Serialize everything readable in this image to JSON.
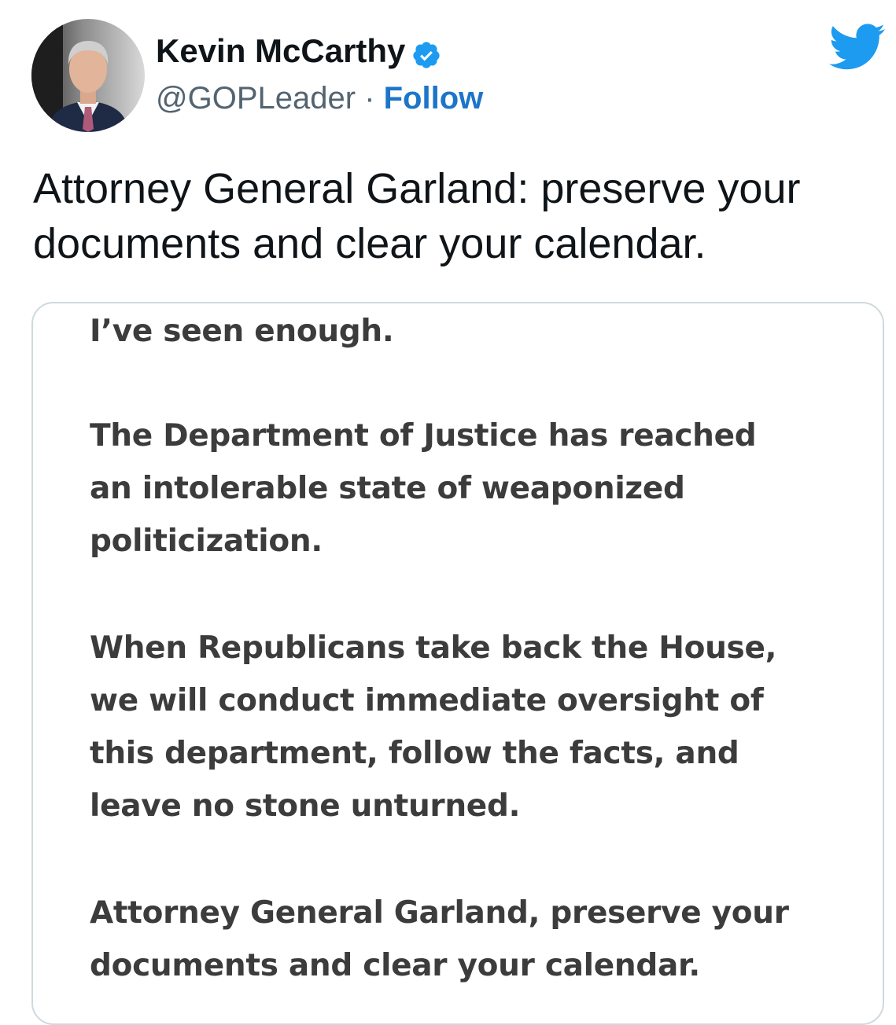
{
  "author": {
    "display_name": "Kevin McCarthy",
    "handle": "@GOPLeader",
    "separator": "·",
    "follow_label": "Follow"
  },
  "icons": {
    "avatar": "profile-photo",
    "verified": "verified-badge-icon",
    "brand": "twitter-bird-icon"
  },
  "colors": {
    "brand_blue": "#1d9bf0",
    "follow_blue": "#1d75c9",
    "statement_text": "#3c3c3c"
  },
  "tweet": {
    "text_line1": "Attorney General Garland: preserve your",
    "text_line2": "documents and clear your calendar."
  },
  "statement": {
    "line1": "I’ve seen enough.",
    "line2": "The Department of Justice has reached",
    "line3": "an intolerable state of weaponized",
    "line4": "politicization.",
    "line5": "When Republicans take back the House,",
    "line6": "we will conduct immediate oversight of",
    "line7": "this department, follow the facts, and",
    "line8": "leave no stone unturned.",
    "line9": "Attorney General Garland, preserve your",
    "line10": "documents and clear your calendar."
  }
}
